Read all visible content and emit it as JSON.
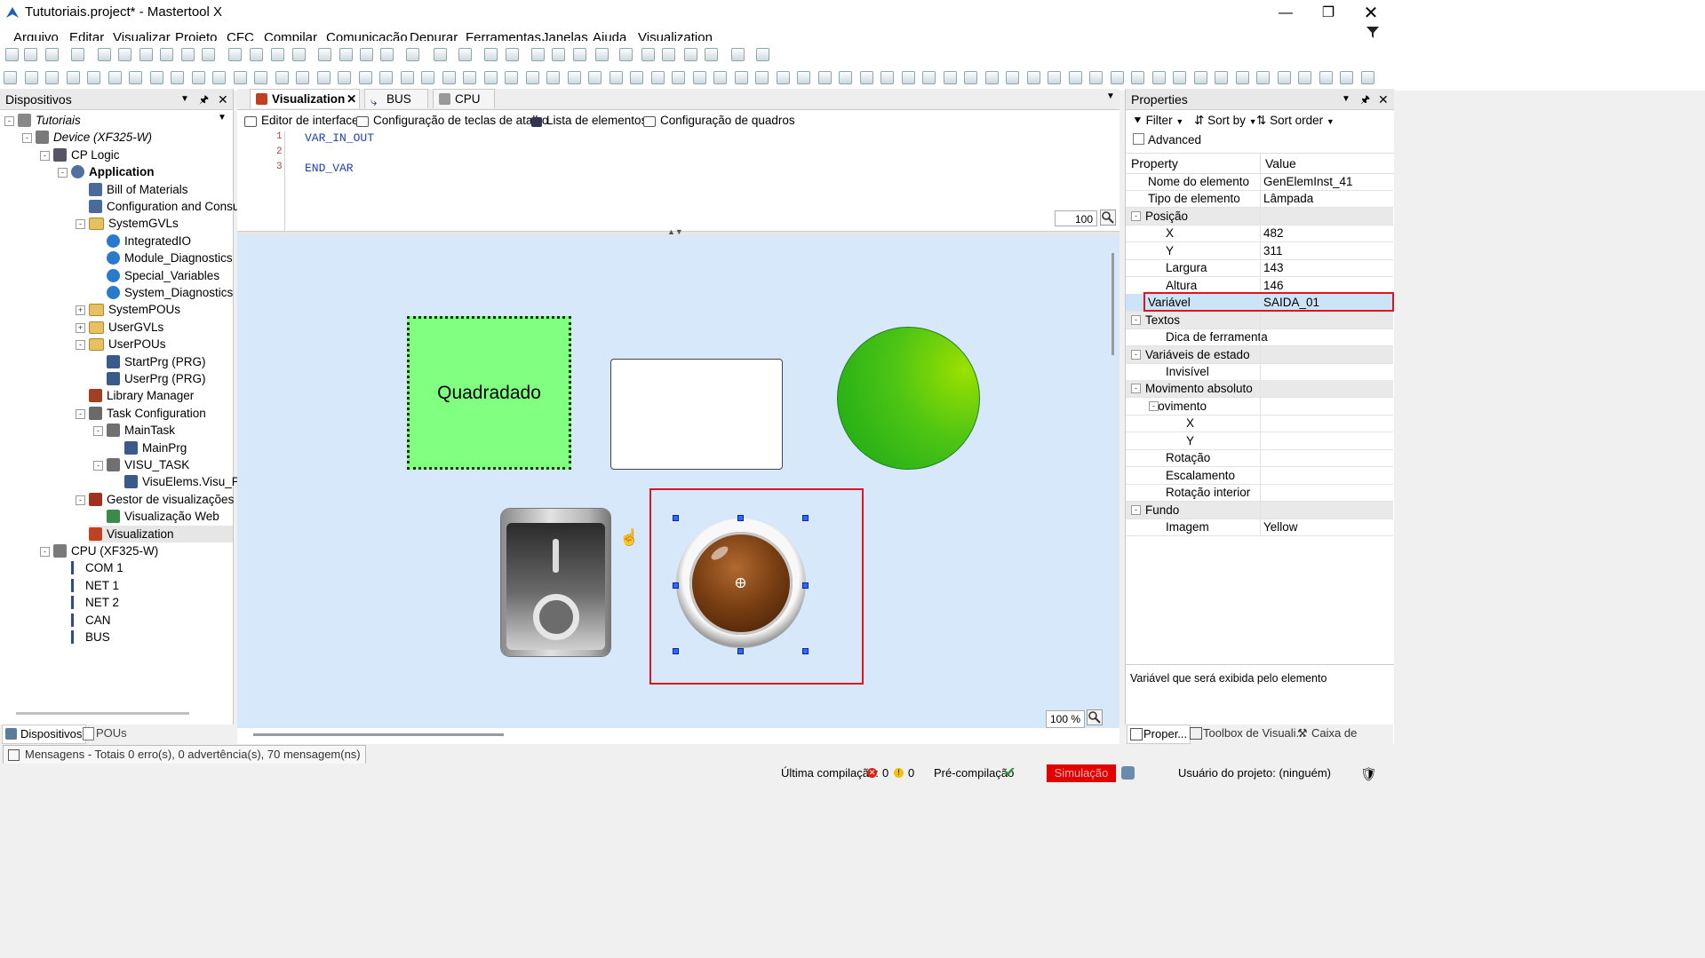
{
  "window": {
    "title": "Tututoriais.project* - Mastertool X",
    "controls": [
      "minimize-icon",
      "restore-icon",
      "close-icon"
    ]
  },
  "menu": [
    "Arquivo",
    "Editar",
    "Visualizar",
    "Projeto",
    "CFC",
    "Compilar",
    "Comunicação",
    "Depurar",
    "Ferramentas",
    "Janelas",
    "Ajuda",
    "Visualization"
  ],
  "devices_panel": {
    "title": "Dispositivos",
    "tree": [
      {
        "label": "Tutoriais",
        "level": 0,
        "italic": true,
        "icon": "project-icon"
      },
      {
        "label": "Device (XF325-W)",
        "level": 1,
        "italic": true,
        "icon": "device-icon"
      },
      {
        "label": "CP Logic",
        "level": 2,
        "icon": "logic-icon"
      },
      {
        "label": "Application",
        "level": 3,
        "bold": true,
        "icon": "gear-icon"
      },
      {
        "label": "Bill of Materials",
        "level": 4,
        "icon": "doc-icon"
      },
      {
        "label": "Configuration and Consump",
        "level": 4,
        "icon": "doc-icon"
      },
      {
        "label": "SystemGVLs",
        "level": 4,
        "icon": "folder-icon"
      },
      {
        "label": "IntegratedIO",
        "level": 5,
        "icon": "globe-icon"
      },
      {
        "label": "Module_Diagnostics",
        "level": 5,
        "icon": "globe-icon"
      },
      {
        "label": "Special_Variables",
        "level": 5,
        "icon": "globe-icon"
      },
      {
        "label": "System_Diagnostics",
        "level": 5,
        "icon": "globe-icon"
      },
      {
        "label": "SystemPOUs",
        "level": 4,
        "icon": "folder-icon"
      },
      {
        "label": "UserGVLs",
        "level": 4,
        "icon": "folder-icon"
      },
      {
        "label": "UserPOUs",
        "level": 4,
        "icon": "folder-icon"
      },
      {
        "label": "StartPrg (PRG)",
        "level": 5,
        "icon": "prg-icon"
      },
      {
        "label": "UserPrg (PRG)",
        "level": 5,
        "icon": "prg-icon"
      },
      {
        "label": "Library Manager",
        "level": 4,
        "icon": "library-icon"
      },
      {
        "label": "Task Configuration",
        "level": 4,
        "icon": "task-config-icon"
      },
      {
        "label": "MainTask",
        "level": 5,
        "icon": "task-icon"
      },
      {
        "label": "MainPrg",
        "level": 6,
        "icon": "prg-icon"
      },
      {
        "label": "VISU_TASK",
        "level": 5,
        "icon": "task-icon"
      },
      {
        "label": "VisuElems.Visu_Prg",
        "level": 6,
        "icon": "prg-icon"
      },
      {
        "label": "Gestor de visualizações",
        "level": 4,
        "icon": "visu-manager-icon"
      },
      {
        "label": "Visualização Web",
        "level": 5,
        "icon": "web-icon"
      },
      {
        "label": "Visualization",
        "level": 4,
        "icon": "visu-icon",
        "selected": true
      },
      {
        "label": "CPU (XF325-W)",
        "level": 2,
        "icon": "device-icon"
      },
      {
        "label": "COM 1",
        "level": 3,
        "icon": "port-icon"
      },
      {
        "label": "NET 1",
        "level": 3,
        "icon": "port-icon"
      },
      {
        "label": "NET 2",
        "level": 3,
        "icon": "port-icon"
      },
      {
        "label": "CAN",
        "level": 3,
        "icon": "port-icon"
      },
      {
        "label": "BUS",
        "level": 3,
        "icon": "port-icon"
      }
    ],
    "bottom_tabs": [
      "Dispositivos",
      "POUs"
    ]
  },
  "editor": {
    "tabs": [
      "Visualization",
      "BUS",
      "CPU"
    ],
    "subtabs": [
      "Editor de interface",
      "Configuração de teclas de atalho",
      "Lista de elementos",
      "Configuração de quadros"
    ],
    "code": [
      {
        "num": "1",
        "text": "VAR_IN_OUT"
      },
      {
        "num": "2",
        "text": ""
      },
      {
        "num": "3",
        "text": "END_VAR"
      }
    ],
    "code_zoom": "100",
    "canvas_zoom": "100 %",
    "elements": {
      "rectangle_label": "Quadradado"
    }
  },
  "properties": {
    "title": "Properties",
    "filter_label": "Filter",
    "sort_by_label": "Sort by",
    "sort_order_label": "Sort order",
    "advanced_label": "Advanced",
    "col_property": "Property",
    "col_value": "Value",
    "rows": [
      {
        "name": "Nome do elemento",
        "value": "GenElemInst_41",
        "indent": 1
      },
      {
        "name": "Tipo de elemento",
        "value": "Lâmpada",
        "indent": 1
      },
      {
        "name": "Posição",
        "value": "",
        "indent": 0,
        "group": true
      },
      {
        "name": "X",
        "value": "482",
        "indent": 2
      },
      {
        "name": "Y",
        "value": "311",
        "indent": 2
      },
      {
        "name": "Largura",
        "value": "143",
        "indent": 2
      },
      {
        "name": "Altura",
        "value": "146",
        "indent": 2
      },
      {
        "name": "Variável",
        "value": "SAIDA_01",
        "indent": 1,
        "highlight": true
      },
      {
        "name": "Textos",
        "value": "",
        "indent": 0,
        "group": true
      },
      {
        "name": "Dica de ferramenta",
        "value": "",
        "indent": 2
      },
      {
        "name": "Variáveis de estado",
        "value": "",
        "indent": 0,
        "group": true
      },
      {
        "name": "Invisível",
        "value": "",
        "indent": 2
      },
      {
        "name": "Movimento absoluto",
        "value": "",
        "indent": 0,
        "group": true
      },
      {
        "name": "Movimento",
        "value": "",
        "indent": 1,
        "group": true
      },
      {
        "name": "X",
        "value": "",
        "indent": 3
      },
      {
        "name": "Y",
        "value": "",
        "indent": 3
      },
      {
        "name": "Rotação",
        "value": "",
        "indent": 2
      },
      {
        "name": "Escalamento",
        "value": "",
        "indent": 2
      },
      {
        "name": "Rotação interior",
        "value": "",
        "indent": 2
      },
      {
        "name": "Fundo",
        "value": "",
        "indent": 0,
        "group": true
      },
      {
        "name": "Imagem",
        "value": "Yellow",
        "indent": 2
      }
    ],
    "description": "Variável que será exibida pelo elemento",
    "bottom_tabs": [
      "Proper...",
      "Toolbox de Visuali...",
      "Caixa de Ferram..."
    ]
  },
  "messages_bar": "Mensagens - Totais 0 erro(s), 0 advertência(s), 70 mensagem(ns)",
  "status": {
    "last_compile": "Última compilação:",
    "errors": "0",
    "warnings": "0",
    "precompile": "Pré-compilação",
    "simulation": "Simulação",
    "user": "Usuário do projeto: (ninguém)"
  },
  "colors": {
    "accent_red": "#e0141e",
    "selection": "#cce4f7",
    "canvas_bg": "#d6e8fa",
    "green_rect": "#80ff80",
    "lamp_green": "#3cc41e"
  }
}
